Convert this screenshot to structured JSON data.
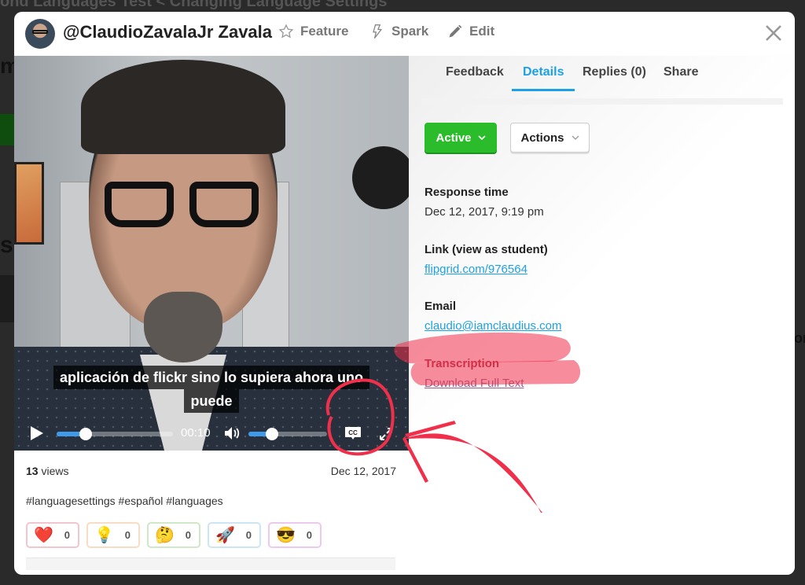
{
  "background": {
    "breadcrumb": "ond Languages Test  <  Changing Language Settings",
    "left_fragments": [
      "m",
      "s"
    ],
    "right_fragment": "on"
  },
  "header": {
    "username": "@ClaudioZavalaJr Zavala",
    "actions": [
      {
        "label": "Feature",
        "icon": "star-icon"
      },
      {
        "label": "Spark",
        "icon": "lightning-icon"
      },
      {
        "label": "Edit",
        "icon": "pencil-icon"
      }
    ],
    "close_icon": "close-icon"
  },
  "video": {
    "captions": [
      "aplicación de flickr sino lo supiera ahora uno",
      "puede"
    ],
    "current_time": "00:10",
    "progress": 0.25,
    "volume": 0.3,
    "cc_label": "CC"
  },
  "meta": {
    "views_count": "13",
    "views_label": "views",
    "date": "Dec 12, 2017",
    "tags": "#languagesettings #español #languages",
    "reactions": [
      {
        "name": "heart",
        "emoji": "❤️",
        "count": "0",
        "color": "#f3c5cf"
      },
      {
        "name": "lightbulb",
        "emoji": "💡",
        "count": "0",
        "color": "#f8dcc4"
      },
      {
        "name": "thinking",
        "emoji": "🤔",
        "count": "0",
        "color": "#cfe8c8"
      },
      {
        "name": "rocket",
        "emoji": "🚀",
        "count": "0",
        "color": "#cde6f4"
      },
      {
        "name": "cool",
        "emoji": "😎",
        "count": "0",
        "color": "#efc8f0"
      }
    ]
  },
  "tabs": [
    {
      "label": "Feedback",
      "active": false
    },
    {
      "label": "Details",
      "active": true
    },
    {
      "label": "Replies (0)",
      "active": false
    },
    {
      "label": "Share",
      "active": false
    }
  ],
  "details": {
    "status_label": "Active",
    "actions_label": "Actions",
    "response_time_label": "Response time",
    "response_time_value": "Dec 12, 2017, 9:19 pm",
    "link_label": "Link (view as student)",
    "link_value": "flipgrid.com/976564",
    "email_label": "Email",
    "email_value": "claudio@iamclaudius.com",
    "transcription_label": "Transcription",
    "transcription_link": "Download Full Text"
  },
  "colors": {
    "accent": "#1da1e6",
    "active_green": "#2bbc2b",
    "annotation_red": "#f0304a"
  }
}
